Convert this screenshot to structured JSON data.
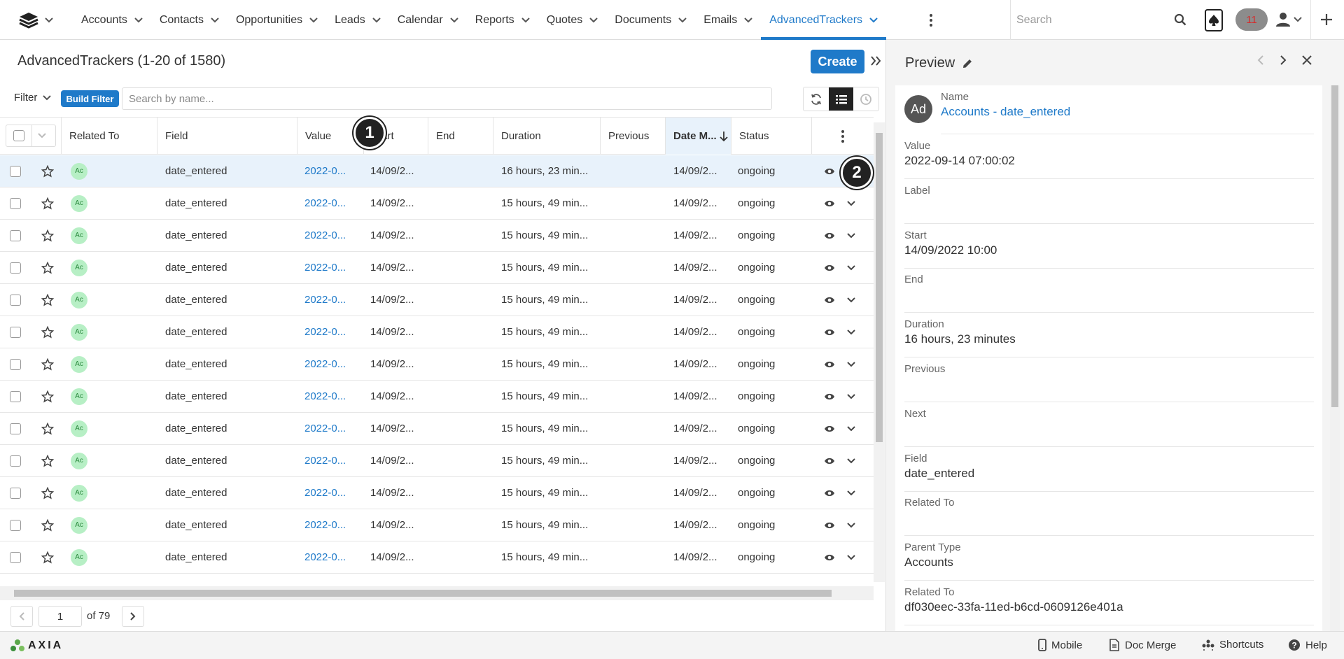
{
  "nav": {
    "tabs": [
      {
        "label": "Accounts",
        "active": false
      },
      {
        "label": "Contacts",
        "active": false
      },
      {
        "label": "Opportunities",
        "active": false
      },
      {
        "label": "Leads",
        "active": false
      },
      {
        "label": "Calendar",
        "active": false
      },
      {
        "label": "Reports",
        "active": false
      },
      {
        "label": "Quotes",
        "active": false
      },
      {
        "label": "Documents",
        "active": false
      },
      {
        "label": "Emails",
        "active": false
      },
      {
        "label": "AdvancedTrackers",
        "active": true
      }
    ],
    "search_placeholder": "Search",
    "notification_count": "11"
  },
  "list": {
    "title": "AdvancedTrackers (1-20 of 1580)",
    "create_label": "Create",
    "filter_label": "Filter",
    "build_filter_label": "Build Filter",
    "search_placeholder": "Search by name...",
    "columns": [
      "Related To",
      "Field",
      "Value",
      "Start",
      "End",
      "Duration",
      "Previous",
      "Date M...",
      "Status"
    ],
    "rows": [
      {
        "avatar": "Ac",
        "field": "date_entered",
        "value": "2022-0...",
        "start": "14/09/2...",
        "end": "",
        "duration": "16 hours, 23 min...",
        "previous": "",
        "date_modified": "14/09/2...",
        "status": "ongoing",
        "highlight": true
      },
      {
        "avatar": "Ac",
        "field": "date_entered",
        "value": "2022-0...",
        "start": "14/09/2...",
        "end": "",
        "duration": "15 hours, 49 min...",
        "previous": "",
        "date_modified": "14/09/2...",
        "status": "ongoing",
        "highlight": false
      },
      {
        "avatar": "Ac",
        "field": "date_entered",
        "value": "2022-0...",
        "start": "14/09/2...",
        "end": "",
        "duration": "15 hours, 49 min...",
        "previous": "",
        "date_modified": "14/09/2...",
        "status": "ongoing",
        "highlight": false
      },
      {
        "avatar": "Ac",
        "field": "date_entered",
        "value": "2022-0...",
        "start": "14/09/2...",
        "end": "",
        "duration": "15 hours, 49 min...",
        "previous": "",
        "date_modified": "14/09/2...",
        "status": "ongoing",
        "highlight": false
      },
      {
        "avatar": "Ac",
        "field": "date_entered",
        "value": "2022-0...",
        "start": "14/09/2...",
        "end": "",
        "duration": "15 hours, 49 min...",
        "previous": "",
        "date_modified": "14/09/2...",
        "status": "ongoing",
        "highlight": false
      },
      {
        "avatar": "Ac",
        "field": "date_entered",
        "value": "2022-0...",
        "start": "14/09/2...",
        "end": "",
        "duration": "15 hours, 49 min...",
        "previous": "",
        "date_modified": "14/09/2...",
        "status": "ongoing",
        "highlight": false
      },
      {
        "avatar": "Ac",
        "field": "date_entered",
        "value": "2022-0...",
        "start": "14/09/2...",
        "end": "",
        "duration": "15 hours, 49 min...",
        "previous": "",
        "date_modified": "14/09/2...",
        "status": "ongoing",
        "highlight": false
      },
      {
        "avatar": "Ac",
        "field": "date_entered",
        "value": "2022-0...",
        "start": "14/09/2...",
        "end": "",
        "duration": "15 hours, 49 min...",
        "previous": "",
        "date_modified": "14/09/2...",
        "status": "ongoing",
        "highlight": false
      },
      {
        "avatar": "Ac",
        "field": "date_entered",
        "value": "2022-0...",
        "start": "14/09/2...",
        "end": "",
        "duration": "15 hours, 49 min...",
        "previous": "",
        "date_modified": "14/09/2...",
        "status": "ongoing",
        "highlight": false
      },
      {
        "avatar": "Ac",
        "field": "date_entered",
        "value": "2022-0...",
        "start": "14/09/2...",
        "end": "",
        "duration": "15 hours, 49 min...",
        "previous": "",
        "date_modified": "14/09/2...",
        "status": "ongoing",
        "highlight": false
      },
      {
        "avatar": "Ac",
        "field": "date_entered",
        "value": "2022-0...",
        "start": "14/09/2...",
        "end": "",
        "duration": "15 hours, 49 min...",
        "previous": "",
        "date_modified": "14/09/2...",
        "status": "ongoing",
        "highlight": false
      },
      {
        "avatar": "Ac",
        "field": "date_entered",
        "value": "2022-0...",
        "start": "14/09/2...",
        "end": "",
        "duration": "15 hours, 49 min...",
        "previous": "",
        "date_modified": "14/09/2...",
        "status": "ongoing",
        "highlight": false
      },
      {
        "avatar": "Ac",
        "field": "date_entered",
        "value": "2022-0...",
        "start": "14/09/2...",
        "end": "",
        "duration": "15 hours, 49 min...",
        "previous": "",
        "date_modified": "14/09/2...",
        "status": "ongoing",
        "highlight": false
      }
    ]
  },
  "pagination": {
    "current_page": "1",
    "of_label": "of 79"
  },
  "preview": {
    "title": "Preview",
    "avatar": "Ad",
    "fields": [
      {
        "label": "Name",
        "value": "Accounts - date_entered",
        "link": true
      },
      {
        "label": "Value",
        "value": "2022-09-14 07:00:02",
        "link": false
      },
      {
        "label": "Label",
        "value": "",
        "link": false
      },
      {
        "label": "Start",
        "value": "14/09/2022 10:00",
        "link": false
      },
      {
        "label": "End",
        "value": "",
        "link": false
      },
      {
        "label": "Duration",
        "value": "16 hours, 23 minutes",
        "link": false
      },
      {
        "label": "Previous",
        "value": "",
        "link": false
      },
      {
        "label": "Next",
        "value": "",
        "link": false
      },
      {
        "label": "Field",
        "value": "date_entered",
        "link": false
      },
      {
        "label": "Related To",
        "value": "",
        "link": false
      },
      {
        "label": "Parent Type",
        "value": "Accounts",
        "link": false
      },
      {
        "label": "Related To",
        "value": "df030eec-33fa-11ed-b6cd-0609126e401a",
        "link": false
      }
    ]
  },
  "footer": {
    "logo_text": "AXIA",
    "links": [
      "Mobile",
      "Doc Merge",
      "Shortcuts",
      "Help"
    ]
  },
  "markers": [
    "1",
    "2"
  ],
  "colors": {
    "accent": "#1f7ac9",
    "row_highlight": "#e8f2fb",
    "avatar_green": "#b7efc5",
    "notif_red": "#d62b2b"
  }
}
